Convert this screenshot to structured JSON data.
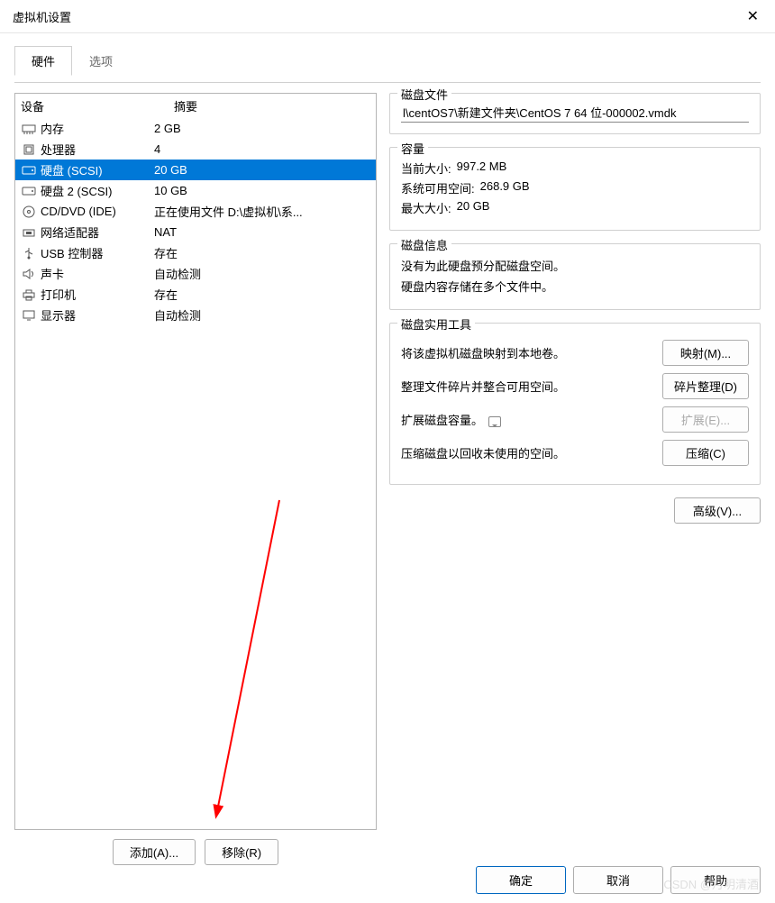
{
  "window": {
    "title": "虚拟机设置"
  },
  "tabs": {
    "hardware": "硬件",
    "options": "选项"
  },
  "columns": {
    "device": "设备",
    "summary": "摘要"
  },
  "devices": [
    {
      "name": "内存",
      "summary": "2 GB",
      "icon": "memory"
    },
    {
      "name": "处理器",
      "summary": "4",
      "icon": "cpu"
    },
    {
      "name": "硬盘 (SCSI)",
      "summary": "20 GB",
      "icon": "disk",
      "selected": true
    },
    {
      "name": "硬盘 2 (SCSI)",
      "summary": "10 GB",
      "icon": "disk"
    },
    {
      "name": "CD/DVD (IDE)",
      "summary": "正在使用文件 D:\\虚拟机\\系...",
      "icon": "cd"
    },
    {
      "name": "网络适配器",
      "summary": "NAT",
      "icon": "net"
    },
    {
      "name": "USB 控制器",
      "summary": "存在",
      "icon": "usb"
    },
    {
      "name": "声卡",
      "summary": "自动检测",
      "icon": "sound"
    },
    {
      "name": "打印机",
      "summary": "存在",
      "icon": "printer"
    },
    {
      "name": "显示器",
      "summary": "自动检测",
      "icon": "display"
    }
  ],
  "buttons": {
    "add": "添加(A)...",
    "remove": "移除(R)"
  },
  "disk_file": {
    "group_title": "磁盘文件",
    "path": "l\\centOS7\\新建文件夹\\CentOS 7 64 位-000002.vmdk"
  },
  "capacity": {
    "group_title": "容量",
    "current_label": "当前大小:",
    "current_value": "997.2 MB",
    "free_label": "系统可用空间:",
    "free_value": "268.9 GB",
    "max_label": "最大大小:",
    "max_value": "20 GB"
  },
  "disk_info": {
    "group_title": "磁盘信息",
    "line1": "没有为此硬盘预分配磁盘空间。",
    "line2": "硬盘内容存储在多个文件中。"
  },
  "tools": {
    "group_title": "磁盘实用工具",
    "map_desc": "将该虚拟机磁盘映射到本地卷。",
    "map_btn": "映射(M)...",
    "defrag_desc": "整理文件碎片并整合可用空间。",
    "defrag_btn": "碎片整理(D)",
    "expand_desc": "扩展磁盘容量。",
    "expand_btn": "扩展(E)...",
    "compact_desc": "压缩磁盘以回收未使用的空间。",
    "compact_btn": "压缩(C)"
  },
  "advanced_btn": "高级(V)...",
  "footer": {
    "ok": "确定",
    "cancel": "取消",
    "help": "帮助"
  },
  "watermark": "CSDN @月明清酒"
}
